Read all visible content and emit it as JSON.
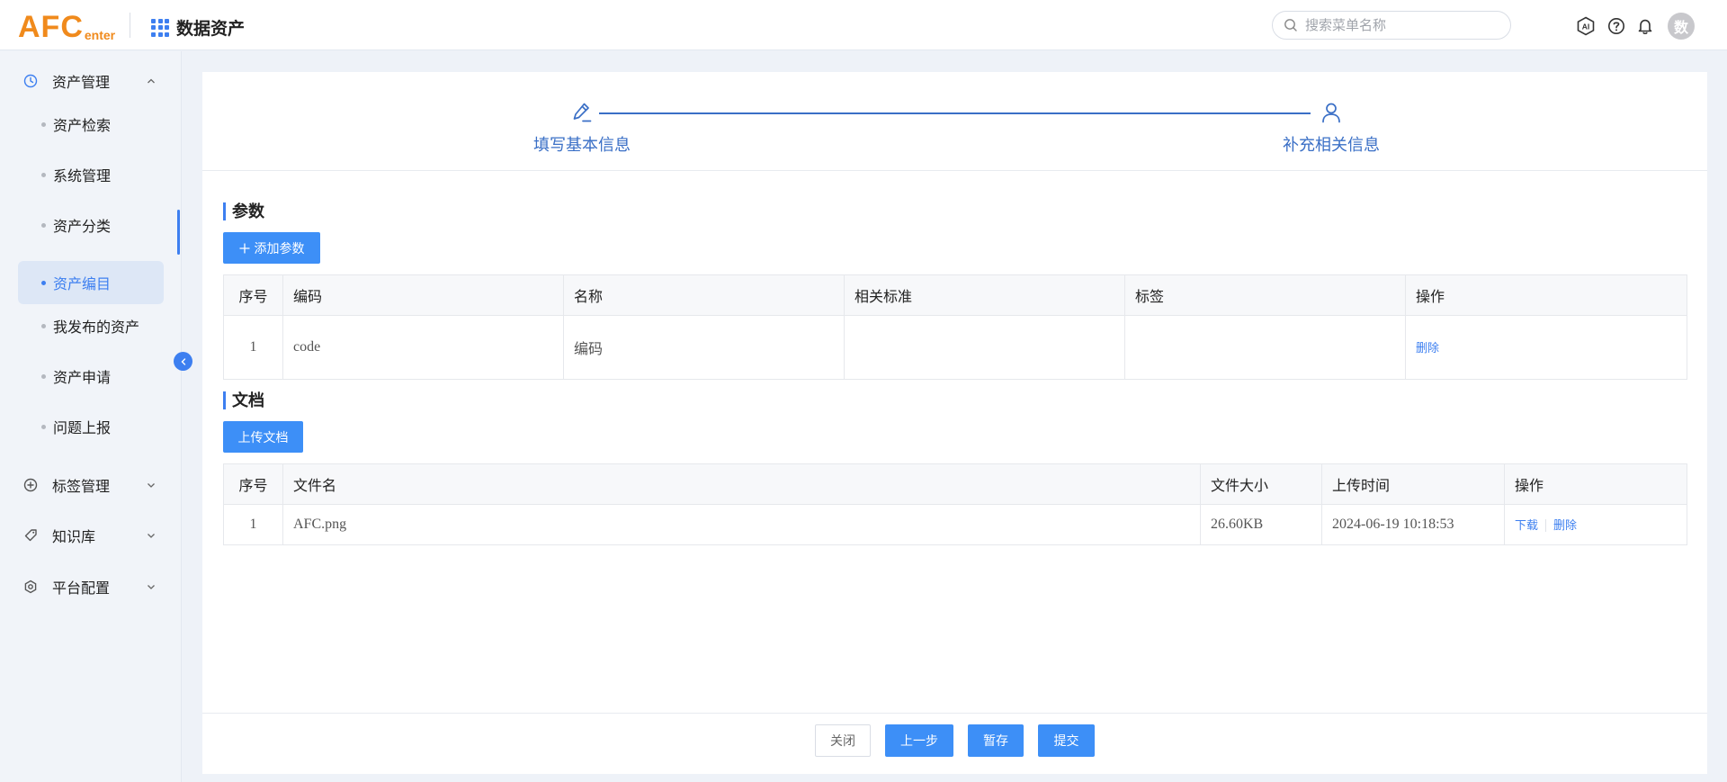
{
  "header": {
    "logo_main": "AFC",
    "logo_sub": "enter",
    "app_title": "数据资产",
    "search_placeholder": "搜索菜单名称",
    "avatar_text": "数",
    "icons": [
      "ai-icon",
      "help-icon",
      "bell-icon"
    ]
  },
  "sidebar": {
    "groups": [
      {
        "label": "资产管理",
        "icon": "clock-icon",
        "expanded": true
      },
      {
        "label": "标签管理",
        "icon": "plus-circle-icon",
        "expanded": false
      },
      {
        "label": "知识库",
        "icon": "tag-icon",
        "expanded": false
      },
      {
        "label": "平台配置",
        "icon": "settings-icon",
        "expanded": false
      }
    ],
    "items": [
      {
        "label": "资产检索",
        "active": false
      },
      {
        "label": "系统管理",
        "active": false
      },
      {
        "label": "资产分类",
        "active": false
      },
      {
        "label": "资产编目",
        "active": true
      },
      {
        "label": "我发布的资产",
        "active": false
      },
      {
        "label": "资产申请",
        "active": false
      },
      {
        "label": "问题上报",
        "active": false
      }
    ]
  },
  "steps": [
    {
      "label": "填写基本信息",
      "icon": "edit-icon"
    },
    {
      "label": "补充相关信息",
      "icon": "user-icon"
    }
  ],
  "params": {
    "title": "参数",
    "add_button": "添加参数",
    "columns": [
      "序号",
      "编码",
      "名称",
      "相关标准",
      "标签",
      "操作"
    ],
    "rows": [
      {
        "index": "1",
        "code": "code",
        "name": "编码",
        "standard": "",
        "tag": "",
        "action": "删除"
      }
    ]
  },
  "docs": {
    "title": "文档",
    "upload_button": "上传文档",
    "columns": [
      "序号",
      "文件名",
      "文件大小",
      "上传时间",
      "操作"
    ],
    "rows": [
      {
        "index": "1",
        "filename": "AFC.png",
        "size": "26.60KB",
        "time": "2024-06-19 10:18:53",
        "download": "下载",
        "delete": "删除"
      }
    ]
  },
  "footer": {
    "close": "关闭",
    "prev": "上一步",
    "save": "暂存",
    "submit": "提交"
  },
  "colors": {
    "primary": "#3d8ff7",
    "logo": "#f08a1c",
    "step": "#3a6fc6"
  }
}
